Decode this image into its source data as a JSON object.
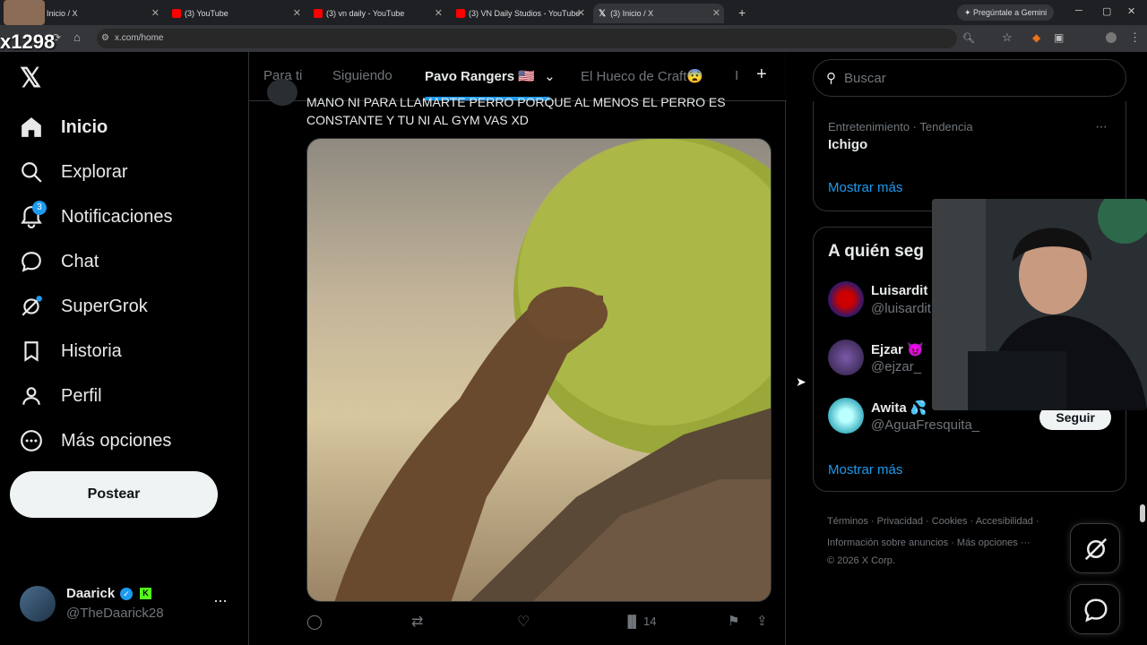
{
  "browser": {
    "tabs": [
      {
        "label": "Inicio / X"
      },
      {
        "label": "(3) YouTube"
      },
      {
        "label": "(3) vn daily - YouTube"
      },
      {
        "label": "(3) VN Daily Studios - YouTube"
      },
      {
        "label": "(3) Inicio / X"
      }
    ],
    "url": "x.com/home",
    "gemini": "Pregúntale a Gemini",
    "overlay_text": "x1298"
  },
  "nav": {
    "items": [
      {
        "label": "Inicio"
      },
      {
        "label": "Explorar"
      },
      {
        "label": "Notificaciones",
        "badge": "3"
      },
      {
        "label": "Chat"
      },
      {
        "label": "SuperGrok"
      },
      {
        "label": "Historia"
      },
      {
        "label": "Perfil"
      },
      {
        "label": "Más opciones"
      }
    ],
    "post_label": "Postear",
    "user": {
      "name": "Daarick",
      "handle": "@TheDaarick28"
    }
  },
  "feed": {
    "tabs": [
      "Para ti",
      "Siguiendo",
      "Pavo Rangers 🇺🇸",
      "El Hueco de Craft😨",
      "I"
    ],
    "post": {
      "text": "MANO NI PARA LLAMARTE PERRO PORQUE AL MENOS EL PERRO ES CONSTANTE Y TU NI AL GYM VAS  XD",
      "views": "14"
    }
  },
  "right": {
    "search_placeholder": "Buscar",
    "trend": {
      "meta": "Entretenimiento · Tendencia",
      "name": "Ichigo",
      "more": "Mostrar más"
    },
    "who_to_follow": {
      "title": "A quién seg",
      "users": [
        {
          "name": "Luisardit",
          "handle": "@luisardit"
        },
        {
          "name": "Ejzar 😈",
          "handle": "@ejzar_"
        },
        {
          "name": "Awita 💦",
          "handle": "@AguaFresquita_",
          "button": "Seguir"
        }
      ],
      "more": "Mostrar más"
    },
    "footer": {
      "line1": [
        "Términos",
        "Privacidad",
        "Cookies",
        "Accesibilidad"
      ],
      "line2": [
        "Información sobre anuncios",
        "Más opciones ···"
      ],
      "copyright": "© 2026 X Corp."
    }
  }
}
